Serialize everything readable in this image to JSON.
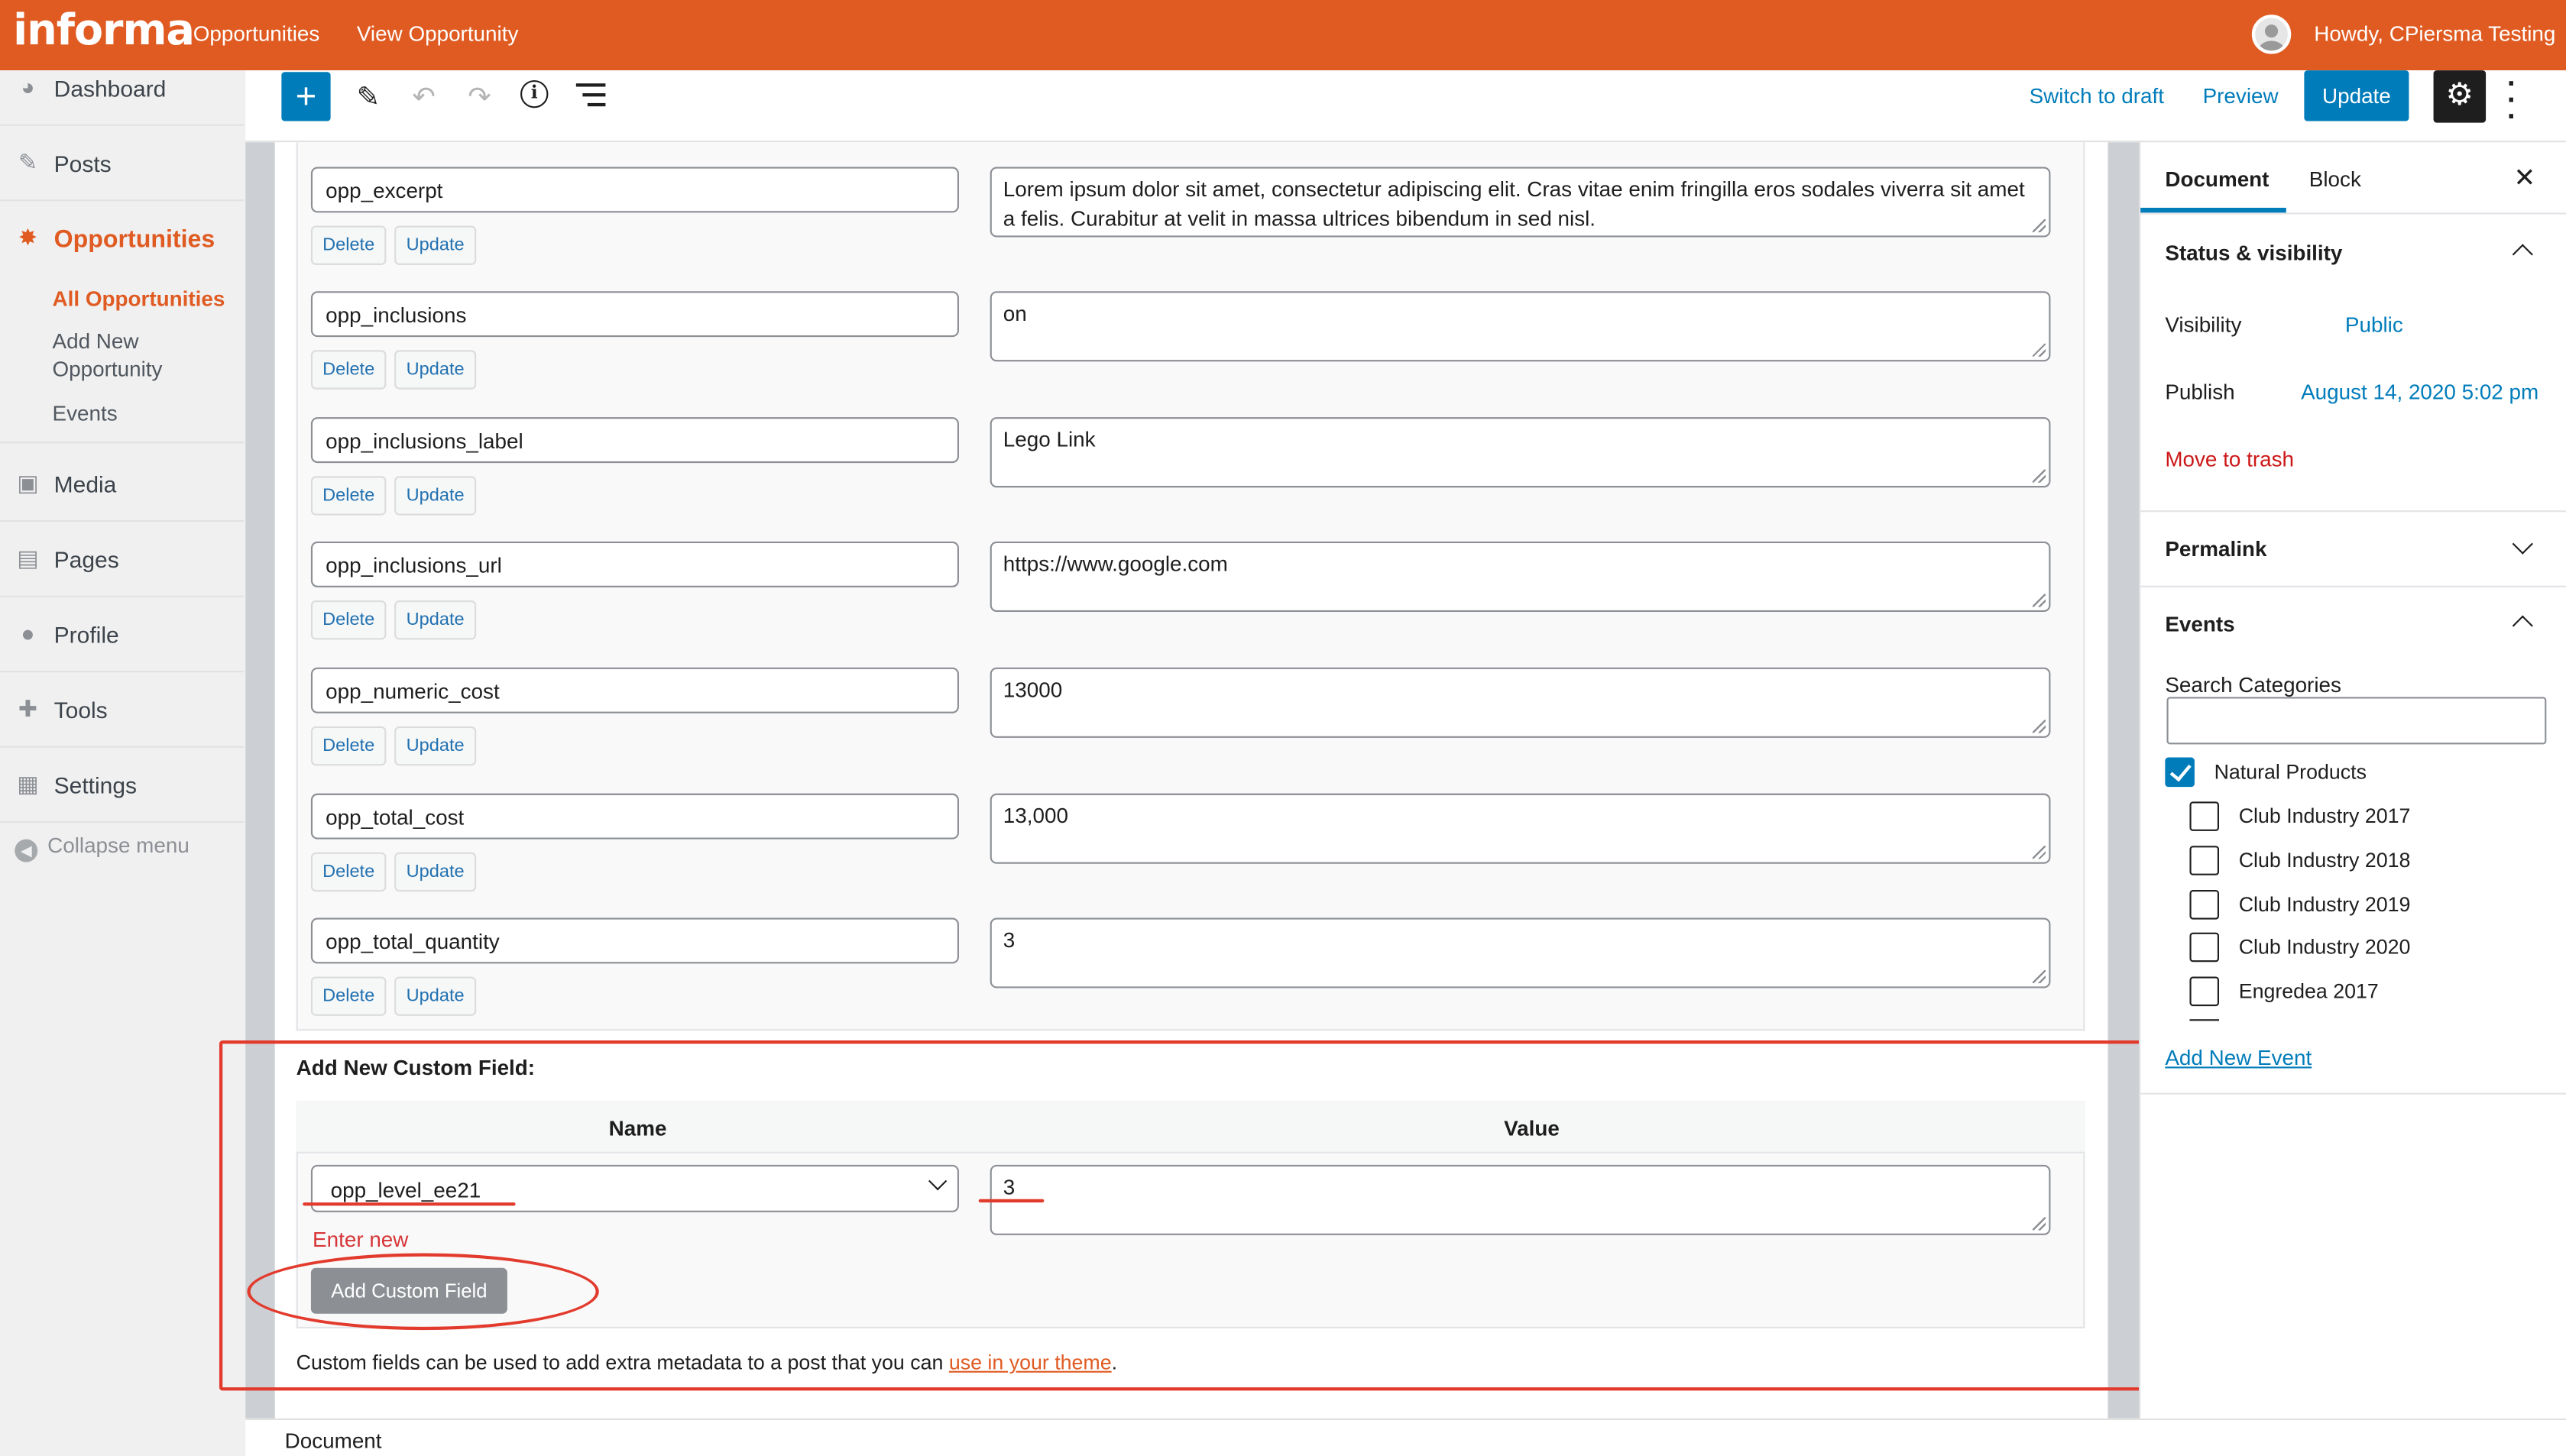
{
  "admin_bar": {
    "logo": "informa",
    "links": [
      "Opportunities",
      "View Opportunity"
    ],
    "howdy": "Howdy, CPiersma Testing"
  },
  "sidebar": {
    "items": [
      {
        "label": "Dashboard",
        "icon": "dashboard-icon"
      },
      {
        "label": "Posts",
        "icon": "pin-icon"
      },
      {
        "label": "Opportunities",
        "icon": "opportunities-icon"
      },
      {
        "label": "Media",
        "icon": "media-icon"
      },
      {
        "label": "Pages",
        "icon": "pages-icon"
      },
      {
        "label": "Profile",
        "icon": "user-icon"
      },
      {
        "label": "Tools",
        "icon": "wrench-icon"
      },
      {
        "label": "Settings",
        "icon": "settings-icon"
      }
    ],
    "submenu": [
      "All Opportunities",
      "Add New",
      "Opportunity",
      "Events"
    ],
    "collapse": "Collapse menu"
  },
  "toolbar": {
    "switch_draft": "Switch to draft",
    "preview": "Preview",
    "update": "Update"
  },
  "custom_fields": {
    "rows": [
      {
        "key": "opp_excerpt",
        "value": "Lorem ipsum dolor sit amet, consectetur adipiscing elit. Cras vitae enim fringilla eros sodales viverra sit amet a felis. Curabitur at velit in massa ultrices bibendum in sed nisl."
      },
      {
        "key": "opp_inclusions",
        "value": "on"
      },
      {
        "key": "opp_inclusions_label",
        "value": "Lego Link"
      },
      {
        "key": "opp_inclusions_url",
        "value": "https://www.google.com"
      },
      {
        "key": "opp_numeric_cost",
        "value": "13000"
      },
      {
        "key": "opp_total_cost",
        "value": "13,000"
      },
      {
        "key": "opp_total_quantity",
        "value": "3"
      }
    ],
    "delete_label": "Delete",
    "update_label": "Update"
  },
  "add_new": {
    "title": "Add New Custom Field:",
    "name_header": "Name",
    "value_header": "Value",
    "selected_name": "opp_level_ee21",
    "value": "3",
    "enter_new": "Enter new",
    "button": "Add Custom Field",
    "help_prefix": "Custom fields can be used to add extra metadata to a post that you can ",
    "help_link": "use in your theme",
    "help_suffix": "."
  },
  "footer": {
    "label": "Document"
  },
  "settings_sidebar": {
    "tabs": [
      "Document",
      "Block"
    ],
    "status_title": "Status & visibility",
    "visibility_label": "Visibility",
    "visibility_value": "Public",
    "publish_label": "Publish",
    "publish_value": "August 14, 2020 5:02 pm",
    "trash": "Move to trash",
    "permalink": "Permalink",
    "events_title": "Events",
    "search_label": "Search Categories",
    "categories": [
      {
        "label": "Natural Products",
        "checked": true
      },
      {
        "label": "Club Industry 2017",
        "checked": false
      },
      {
        "label": "Club Industry 2018",
        "checked": false
      },
      {
        "label": "Club Industry 2019",
        "checked": false
      },
      {
        "label": "Club Industry 2020",
        "checked": false
      },
      {
        "label": "Engredea 2017",
        "checked": false
      }
    ],
    "add_event": "Add New Event"
  },
  "colors": {
    "brand": "#e05b22",
    "wp_blue": "#007cba",
    "annotation": "#e23b2e"
  }
}
